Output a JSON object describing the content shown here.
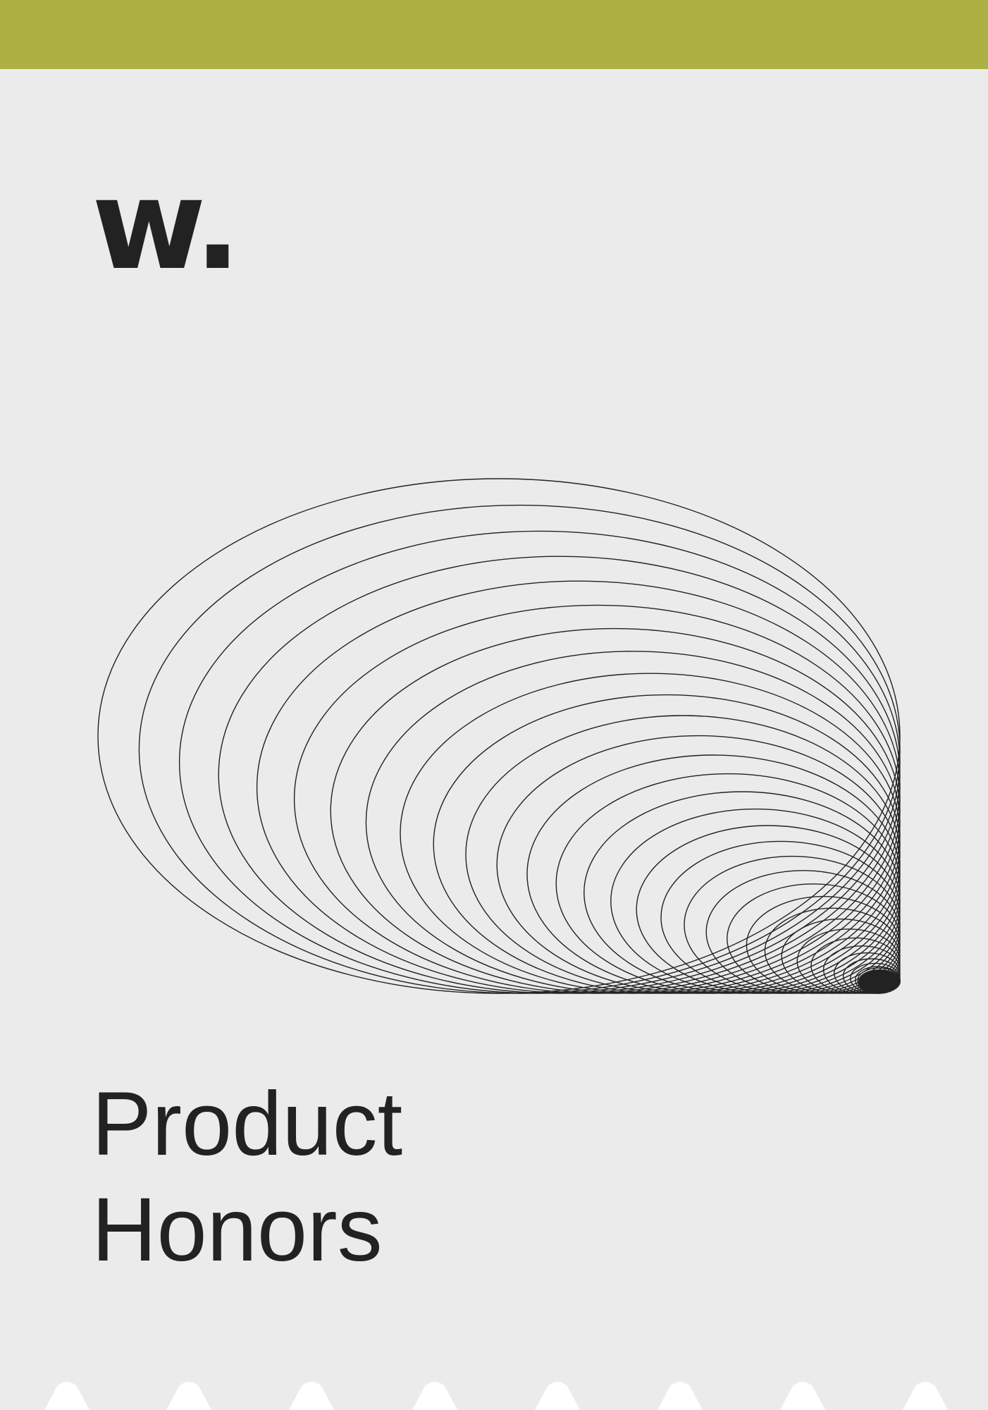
{
  "poster": {
    "logo": "w.",
    "title_lines": [
      "Product",
      "Honors"
    ]
  },
  "colors": {
    "accent": "#adb143",
    "background": "#ebebeb",
    "ink": "#222222",
    "edge": "#ffffff"
  },
  "icons": {
    "artwork": "nested-ellipses-icon",
    "edge": "scalloped-edge-icon"
  }
}
